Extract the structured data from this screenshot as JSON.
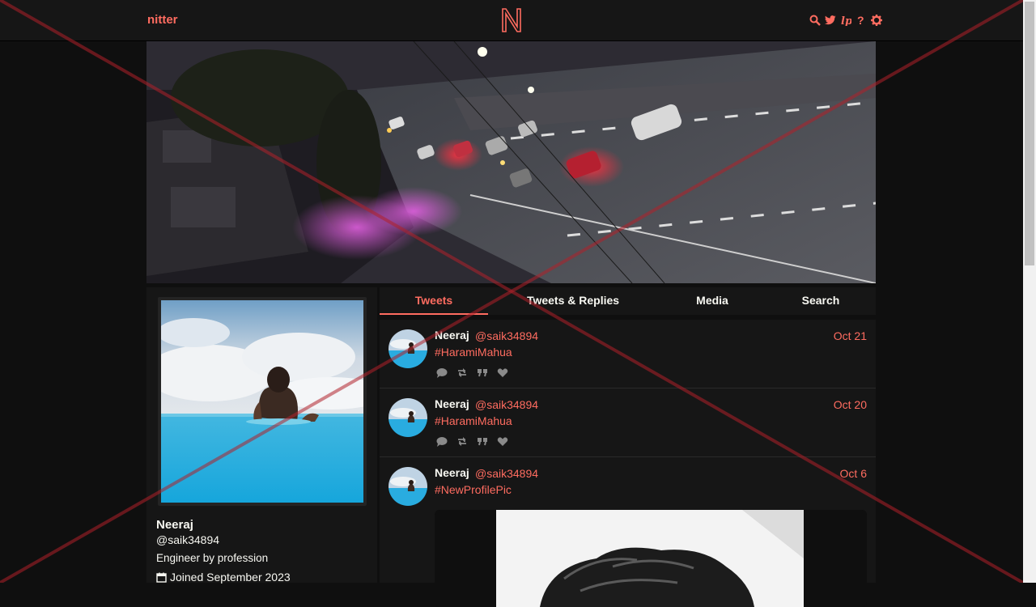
{
  "nav": {
    "brand": "nitter",
    "logo_letter": "N",
    "icons": [
      "search-icon",
      "twitter-icon",
      "liberapay-icon",
      "help-icon",
      "settings-icon"
    ]
  },
  "profile": {
    "name": "Neeraj",
    "handle": "@saik34894",
    "bio": "Engineer by profession",
    "joined": "Joined September 2023"
  },
  "tabs": [
    {
      "label": "Tweets",
      "active": true
    },
    {
      "label": "Tweets & Replies",
      "active": false
    },
    {
      "label": "Media",
      "active": false
    },
    {
      "label": "Search",
      "active": false
    }
  ],
  "tweets": [
    {
      "name": "Neeraj",
      "handle": "@saik34894",
      "date": "Oct 21",
      "text": "#HaramiMahua"
    },
    {
      "name": "Neeraj",
      "handle": "@saik34894",
      "date": "Oct 20",
      "text": "#HaramiMahua"
    },
    {
      "name": "Neeraj",
      "handle": "@saik34894",
      "date": "Oct 6",
      "text": "#NewProfilePic"
    }
  ],
  "colors": {
    "accent": "#ff6c60",
    "background": "#0f0f0f",
    "panel": "#161616",
    "text": "#f8f8f2"
  }
}
